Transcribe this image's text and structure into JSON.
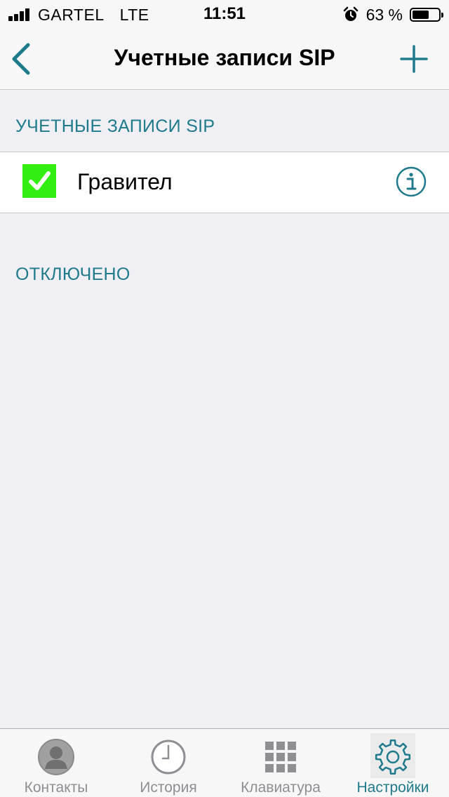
{
  "status_bar": {
    "carrier": "GARTEL",
    "network": "LTE",
    "time": "11:51",
    "battery_percent": "63 %",
    "battery_level": 0.63,
    "alarm_icon": "alarm-clock-icon",
    "signal_icon": "signal-bars-icon"
  },
  "nav": {
    "title": "Учетные записи SIP",
    "back_icon": "chevron-left-icon",
    "add_icon": "plus-icon"
  },
  "sections": {
    "accounts_header": "УЧЕТНЫЕ ЗАПИСИ SIP",
    "disabled_header": "ОТКЛЮЧЕНО"
  },
  "accounts": [
    {
      "name": "Гравител",
      "status_icon": "checkmark-icon",
      "status_color": "#33ee11",
      "info_icon": "info-circle-icon"
    }
  ],
  "tabs": [
    {
      "label": "Контакты",
      "icon": "contact-person-icon",
      "active": false
    },
    {
      "label": "История",
      "icon": "clock-icon",
      "active": false
    },
    {
      "label": "Клавиатура",
      "icon": "keypad-icon",
      "active": false
    },
    {
      "label": "Настройки",
      "icon": "gear-icon",
      "active": true
    }
  ],
  "colors": {
    "accent": "#1f7a8c",
    "background": "#efeff4",
    "inactive_tab": "#8e8e93"
  }
}
